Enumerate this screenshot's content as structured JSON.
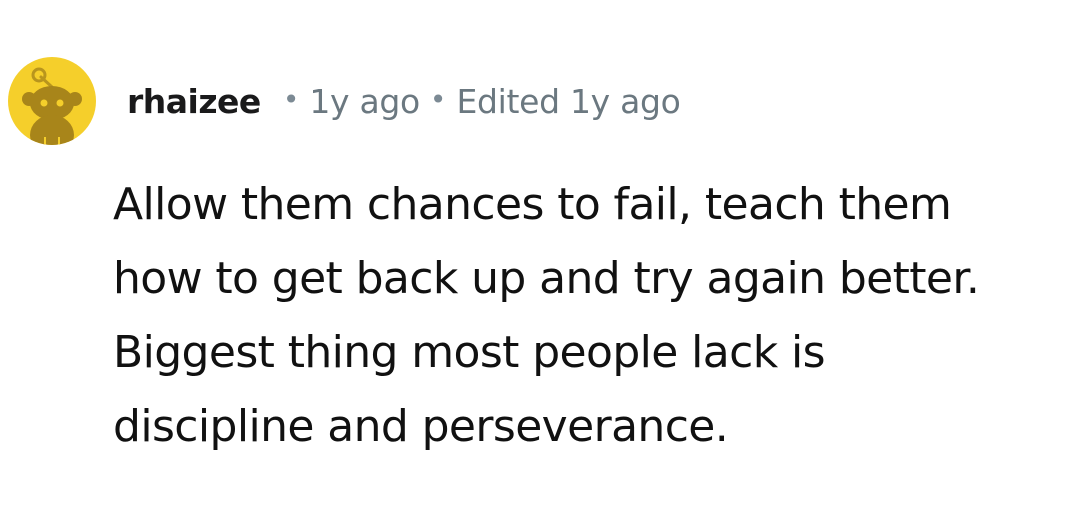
{
  "comment": {
    "username": "rhaizee",
    "separator": "•",
    "time_ago": "1y ago",
    "edited": "Edited 1y ago",
    "avatar_icon": "snoo-avatar-icon",
    "avatar_color": "#f5cf2b",
    "body_lines": [
      "Allow them chances to fail, teach them",
      "how to get back up and try again better.",
      "Biggest thing most people lack is",
      "discipline and perseverance."
    ]
  }
}
